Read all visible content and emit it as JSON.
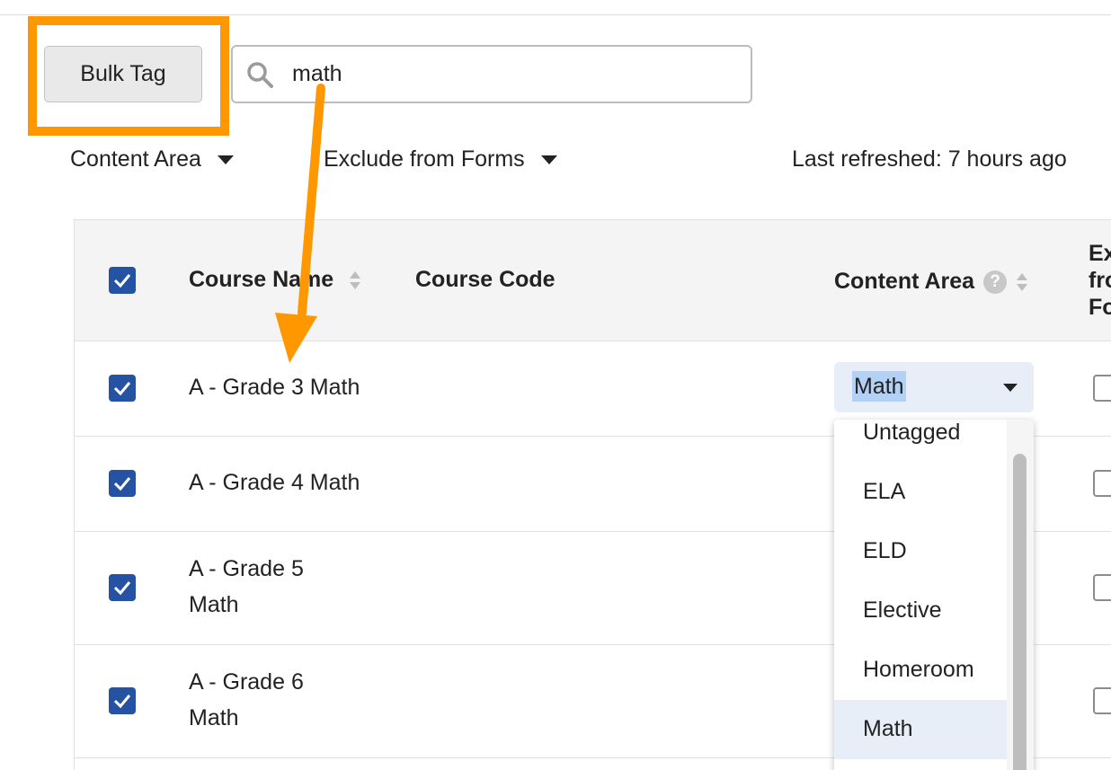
{
  "toolbar": {
    "bulk_tag_label": "Bulk Tag",
    "search_value": "math"
  },
  "filters": {
    "content_area_label": "Content Area",
    "exclude_label": "Exclude from Forms"
  },
  "status": {
    "last_refreshed": "Last refreshed: 7 hours ago"
  },
  "table": {
    "headers": {
      "course_name": "Course Name",
      "course_code": "Course Code",
      "content_area": "Content Area",
      "help_glyph": "?",
      "exclude_line1": "Ex",
      "exclude_line2": "fro",
      "exclude_line3": "Fo"
    },
    "rows": [
      {
        "name_line1": "A - Grade 3 Math",
        "name_line2": ""
      },
      {
        "name_line1": "A - Grade 4 Math",
        "name_line2": ""
      },
      {
        "name_line1": "A - Grade 5",
        "name_line2": "Math"
      },
      {
        "name_line1": "A - Grade 6",
        "name_line2": "Math"
      }
    ],
    "content_area_selected": "Math"
  },
  "dropdown": {
    "options": [
      "Untagged",
      "ELA",
      "ELD",
      "Elective",
      "Homeroom",
      "Math"
    ],
    "selected": "Math"
  },
  "colors": {
    "highlight": "#ff9800",
    "checkbox": "#2552a2",
    "arrow": "#ff9800"
  },
  "icons": {
    "search": "search-icon",
    "sort": "sort-icon",
    "help": "help-icon",
    "caret": "caret-down-icon",
    "check": "check-icon"
  }
}
